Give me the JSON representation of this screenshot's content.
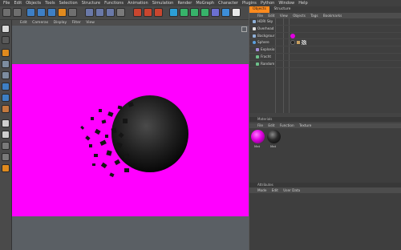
{
  "menubar": {
    "items": [
      "File",
      "Edit",
      "Objects",
      "Tools",
      "Selection",
      "Structure",
      "Functions",
      "Animation",
      "Simulation",
      "Render",
      "MoGraph",
      "Character",
      "Plugins",
      "Python",
      "Window",
      "Help"
    ]
  },
  "viewport": {
    "menu": [
      "Edit",
      "Cameras",
      "Display",
      "Filter",
      "View"
    ]
  },
  "object_manager": {
    "tabs": [
      "Objects",
      "Structure"
    ],
    "active_tab": "Objects",
    "menu": [
      "File",
      "Edit",
      "View",
      "Objects",
      "Tags",
      "Bookmarks"
    ],
    "objects": [
      {
        "name": "HDRI Sky"
      },
      {
        "name": "Overhead"
      },
      {
        "name": "Backgrour"
      },
      {
        "name": "Sphere"
      },
      {
        "name": "Explosio"
      },
      {
        "name": "Fracht"
      },
      {
        "name": "Random"
      }
    ]
  },
  "materials": {
    "title": "Materials",
    "menu": [
      "File",
      "Edit",
      "Function",
      "Texture"
    ],
    "items": [
      {
        "label": "Mat",
        "color": "#e000e0"
      },
      {
        "label": "Mat",
        "color": "#2a2a2a"
      }
    ]
  },
  "attributes": {
    "title": "Attributes",
    "menu": [
      "Mode",
      "Edit",
      "User Data"
    ]
  },
  "colors": {
    "accent": "#ff8a1d",
    "background_magenta": "#ff00ff"
  }
}
